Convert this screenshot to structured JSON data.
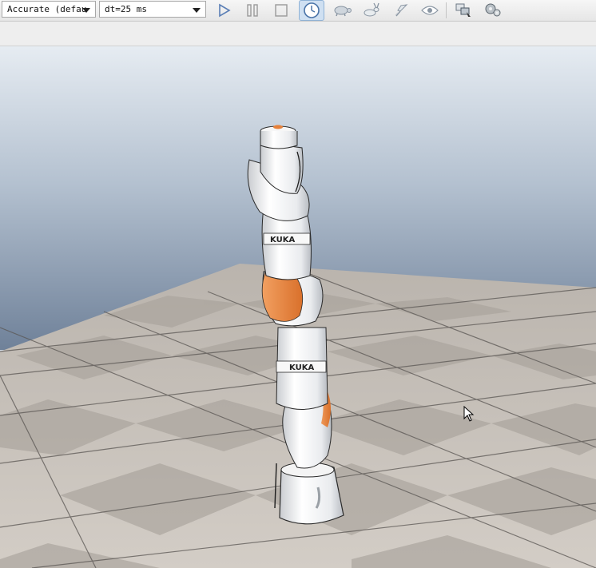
{
  "toolbar": {
    "engine_select": {
      "value": "Accurate (defau"
    },
    "dt_select": {
      "value": "dt=25 ms"
    },
    "buttons": {
      "play": "play-icon",
      "pause": "pause-icon",
      "stop": "stop-icon",
      "realtime": "clock-icon",
      "slow": "turtle-icon",
      "fast": "rabbit-icon",
      "threaded": "rocket-icon",
      "visualize": "eye-icon",
      "page_swap": "windows-icon",
      "ik": "gears-icon"
    }
  },
  "scene": {
    "robot_brand_upper": "KUKA",
    "robot_brand_lower": "KUKA",
    "colors": {
      "sky_top": "#dfe6ee",
      "sky_bottom": "#7d8ea5",
      "floor_light": "#cfc9c2",
      "floor_dark": "#b7b1aa",
      "robot_white": "#f2f2f2",
      "robot_orange": "#e6813b"
    }
  }
}
